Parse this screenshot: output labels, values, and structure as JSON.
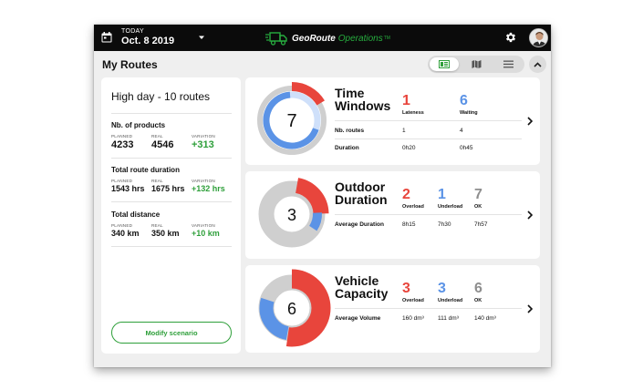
{
  "header": {
    "today_label": "TODAY",
    "date": "Oct. 8 2019",
    "calendar_icon": "calendar-icon",
    "brand_name": "GeoRoute",
    "brand_sub": "Operations",
    "brand_tm": "TM",
    "brand_color": "#27ae3f"
  },
  "page": {
    "title": "My Routes",
    "views": [
      "table-view-icon",
      "map-icon",
      "list-icon"
    ],
    "active_view": "table-view-icon"
  },
  "summary": {
    "title": "High day - 10 routes",
    "labels": {
      "planned": "PLANNED",
      "real": "REAL",
      "variation": "VARIATION"
    },
    "metrics": [
      {
        "title": "Nb. of products",
        "planned": "4233",
        "real": "4546",
        "variation": "+313"
      },
      {
        "title": "Total route duration",
        "planned": "1543 hrs",
        "real": "1675 hrs",
        "variation": "+132 hrs"
      },
      {
        "title": "Total distance",
        "planned": "340 km",
        "real": "350 km",
        "variation": "+10 km"
      }
    ],
    "button": "Modify scenario"
  },
  "colors": {
    "red": "#e8453c",
    "blue": "#5b93e6",
    "grey": "#cfcfcf",
    "green": "#2e9f3a"
  },
  "cards": [
    {
      "title_line1": "Time",
      "title_line2": "Windows",
      "center_value": "7",
      "segments": {
        "red": 1,
        "blue": 6,
        "grey": 0
      },
      "stats": [
        {
          "value": "1",
          "label": "Lateness"
        },
        {
          "value": "6",
          "label": "Waiting"
        }
      ],
      "rows": [
        {
          "label": "Nb. routes",
          "values": [
            "1",
            "4"
          ]
        },
        {
          "label": "Duration",
          "values": [
            "0h20",
            "0h45"
          ]
        }
      ]
    },
    {
      "title_line1": "Outdoor",
      "title_line2": "Duration",
      "center_value": "3",
      "segments": {
        "red": 2,
        "blue": 1,
        "grey": 7
      },
      "stats": [
        {
          "value": "2",
          "label": "Overload"
        },
        {
          "value": "1",
          "label": "Underload"
        },
        {
          "value": "7",
          "label": "OK"
        }
      ],
      "rows": [
        {
          "label": "Average Duration",
          "values": [
            "8h15",
            "7h30",
            "7h57"
          ]
        }
      ]
    },
    {
      "title_line1": "Vehicle",
      "title_line2": "Capacity",
      "center_value": "6",
      "segments": {
        "red": 3,
        "blue": 3,
        "grey": 6
      },
      "stats": [
        {
          "value": "3",
          "label": "Overload"
        },
        {
          "value": "3",
          "label": "Underload"
        },
        {
          "value": "6",
          "label": "OK"
        }
      ],
      "rows": [
        {
          "label": "Average Volume",
          "values": [
            "160 dm³",
            "111 dm³",
            "140 dm³"
          ]
        }
      ]
    }
  ]
}
